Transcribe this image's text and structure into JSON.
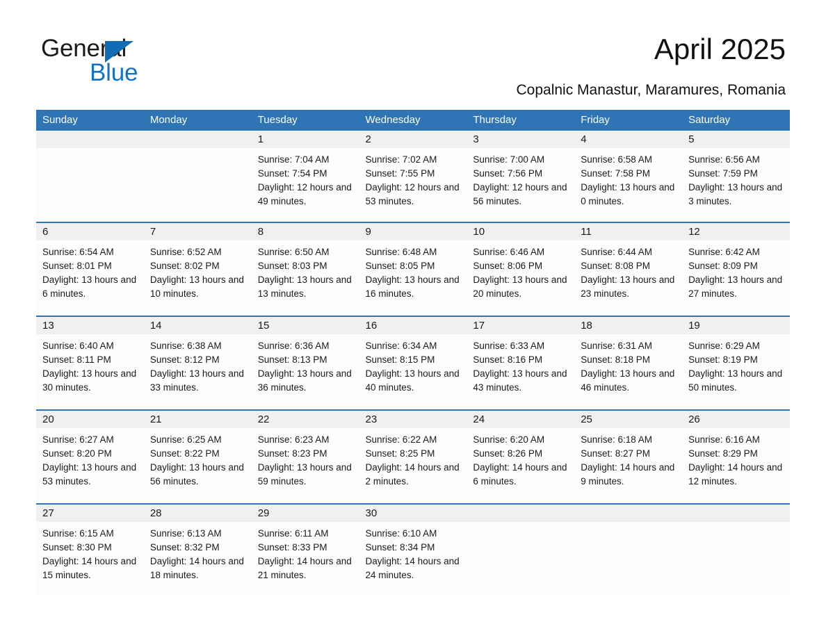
{
  "logo": {
    "word_one": "General",
    "word_two": "Blue",
    "triangle_color": "#0f6cb5",
    "blue_text_color": "#1273c4"
  },
  "header": {
    "title": "April 2025",
    "subtitle": "Copalnic Manastur, Maramures, Romania"
  },
  "theme": {
    "header_blue": "#2f75b5",
    "daynum_band": "#f0f0f0",
    "cell_bg": "#fdfdfd",
    "text": "#1a1a1a"
  },
  "weekdays": [
    "Sunday",
    "Monday",
    "Tuesday",
    "Wednesday",
    "Thursday",
    "Friday",
    "Saturday"
  ],
  "weeks": [
    [
      {
        "day": "",
        "sunrise": "",
        "sunset": "",
        "daylight": "",
        "empty": true
      },
      {
        "day": "",
        "sunrise": "",
        "sunset": "",
        "daylight": "",
        "empty": true
      },
      {
        "day": "1",
        "sunrise": "Sunrise: 7:04 AM",
        "sunset": "Sunset: 7:54 PM",
        "daylight": "Daylight: 12 hours and 49 minutes."
      },
      {
        "day": "2",
        "sunrise": "Sunrise: 7:02 AM",
        "sunset": "Sunset: 7:55 PM",
        "daylight": "Daylight: 12 hours and 53 minutes."
      },
      {
        "day": "3",
        "sunrise": "Sunrise: 7:00 AM",
        "sunset": "Sunset: 7:56 PM",
        "daylight": "Daylight: 12 hours and 56 minutes."
      },
      {
        "day": "4",
        "sunrise": "Sunrise: 6:58 AM",
        "sunset": "Sunset: 7:58 PM",
        "daylight": "Daylight: 13 hours and 0 minutes."
      },
      {
        "day": "5",
        "sunrise": "Sunrise: 6:56 AM",
        "sunset": "Sunset: 7:59 PM",
        "daylight": "Daylight: 13 hours and 3 minutes."
      }
    ],
    [
      {
        "day": "6",
        "sunrise": "Sunrise: 6:54 AM",
        "sunset": "Sunset: 8:01 PM",
        "daylight": "Daylight: 13 hours and 6 minutes."
      },
      {
        "day": "7",
        "sunrise": "Sunrise: 6:52 AM",
        "sunset": "Sunset: 8:02 PM",
        "daylight": "Daylight: 13 hours and 10 minutes."
      },
      {
        "day": "8",
        "sunrise": "Sunrise: 6:50 AM",
        "sunset": "Sunset: 8:03 PM",
        "daylight": "Daylight: 13 hours and 13 minutes."
      },
      {
        "day": "9",
        "sunrise": "Sunrise: 6:48 AM",
        "sunset": "Sunset: 8:05 PM",
        "daylight": "Daylight: 13 hours and 16 minutes."
      },
      {
        "day": "10",
        "sunrise": "Sunrise: 6:46 AM",
        "sunset": "Sunset: 8:06 PM",
        "daylight": "Daylight: 13 hours and 20 minutes."
      },
      {
        "day": "11",
        "sunrise": "Sunrise: 6:44 AM",
        "sunset": "Sunset: 8:08 PM",
        "daylight": "Daylight: 13 hours and 23 minutes."
      },
      {
        "day": "12",
        "sunrise": "Sunrise: 6:42 AM",
        "sunset": "Sunset: 8:09 PM",
        "daylight": "Daylight: 13 hours and 27 minutes."
      }
    ],
    [
      {
        "day": "13",
        "sunrise": "Sunrise: 6:40 AM",
        "sunset": "Sunset: 8:11 PM",
        "daylight": "Daylight: 13 hours and 30 minutes."
      },
      {
        "day": "14",
        "sunrise": "Sunrise: 6:38 AM",
        "sunset": "Sunset: 8:12 PM",
        "daylight": "Daylight: 13 hours and 33 minutes."
      },
      {
        "day": "15",
        "sunrise": "Sunrise: 6:36 AM",
        "sunset": "Sunset: 8:13 PM",
        "daylight": "Daylight: 13 hours and 36 minutes."
      },
      {
        "day": "16",
        "sunrise": "Sunrise: 6:34 AM",
        "sunset": "Sunset: 8:15 PM",
        "daylight": "Daylight: 13 hours and 40 minutes."
      },
      {
        "day": "17",
        "sunrise": "Sunrise: 6:33 AM",
        "sunset": "Sunset: 8:16 PM",
        "daylight": "Daylight: 13 hours and 43 minutes."
      },
      {
        "day": "18",
        "sunrise": "Sunrise: 6:31 AM",
        "sunset": "Sunset: 8:18 PM",
        "daylight": "Daylight: 13 hours and 46 minutes."
      },
      {
        "day": "19",
        "sunrise": "Sunrise: 6:29 AM",
        "sunset": "Sunset: 8:19 PM",
        "daylight": "Daylight: 13 hours and 50 minutes."
      }
    ],
    [
      {
        "day": "20",
        "sunrise": "Sunrise: 6:27 AM",
        "sunset": "Sunset: 8:20 PM",
        "daylight": "Daylight: 13 hours and 53 minutes."
      },
      {
        "day": "21",
        "sunrise": "Sunrise: 6:25 AM",
        "sunset": "Sunset: 8:22 PM",
        "daylight": "Daylight: 13 hours and 56 minutes."
      },
      {
        "day": "22",
        "sunrise": "Sunrise: 6:23 AM",
        "sunset": "Sunset: 8:23 PM",
        "daylight": "Daylight: 13 hours and 59 minutes."
      },
      {
        "day": "23",
        "sunrise": "Sunrise: 6:22 AM",
        "sunset": "Sunset: 8:25 PM",
        "daylight": "Daylight: 14 hours and 2 minutes."
      },
      {
        "day": "24",
        "sunrise": "Sunrise: 6:20 AM",
        "sunset": "Sunset: 8:26 PM",
        "daylight": "Daylight: 14 hours and 6 minutes."
      },
      {
        "day": "25",
        "sunrise": "Sunrise: 6:18 AM",
        "sunset": "Sunset: 8:27 PM",
        "daylight": "Daylight: 14 hours and 9 minutes."
      },
      {
        "day": "26",
        "sunrise": "Sunrise: 6:16 AM",
        "sunset": "Sunset: 8:29 PM",
        "daylight": "Daylight: 14 hours and 12 minutes."
      }
    ],
    [
      {
        "day": "27",
        "sunrise": "Sunrise: 6:15 AM",
        "sunset": "Sunset: 8:30 PM",
        "daylight": "Daylight: 14 hours and 15 minutes."
      },
      {
        "day": "28",
        "sunrise": "Sunrise: 6:13 AM",
        "sunset": "Sunset: 8:32 PM",
        "daylight": "Daylight: 14 hours and 18 minutes."
      },
      {
        "day": "29",
        "sunrise": "Sunrise: 6:11 AM",
        "sunset": "Sunset: 8:33 PM",
        "daylight": "Daylight: 14 hours and 21 minutes."
      },
      {
        "day": "30",
        "sunrise": "Sunrise: 6:10 AM",
        "sunset": "Sunset: 8:34 PM",
        "daylight": "Daylight: 14 hours and 24 minutes."
      },
      {
        "day": "",
        "sunrise": "",
        "sunset": "",
        "daylight": "",
        "empty": true
      },
      {
        "day": "",
        "sunrise": "",
        "sunset": "",
        "daylight": "",
        "empty": true
      },
      {
        "day": "",
        "sunrise": "",
        "sunset": "",
        "daylight": "",
        "empty": true
      }
    ]
  ]
}
